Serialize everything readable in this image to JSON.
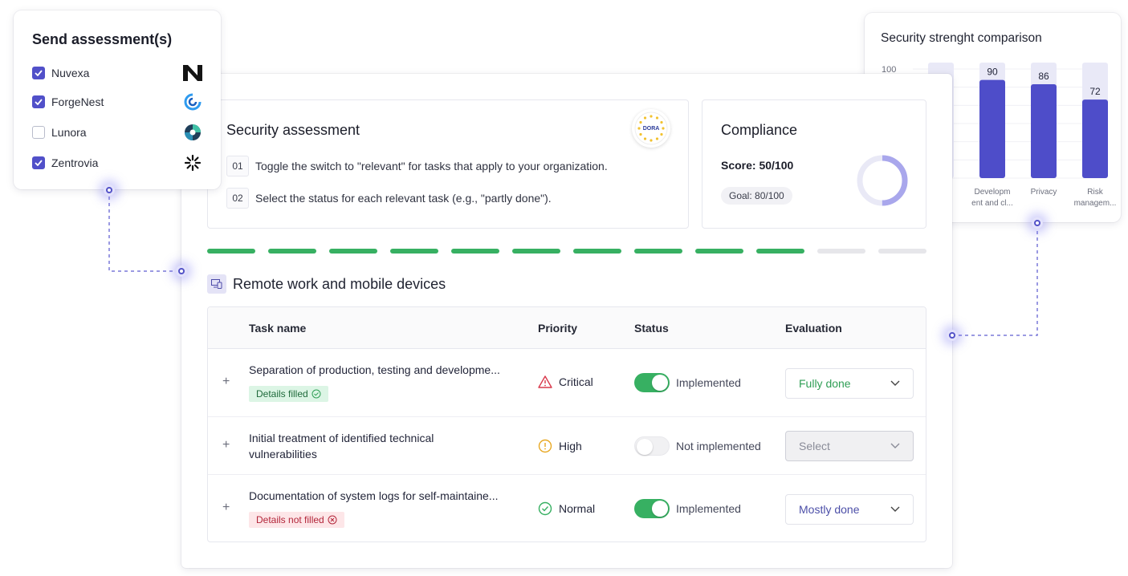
{
  "send_assessments": {
    "title": "Send assessment(s)",
    "orgs": [
      {
        "name": "Nuvexa",
        "checked": true,
        "logo": "nuvexa-logo-icon"
      },
      {
        "name": "ForgeNest",
        "checked": true,
        "logo": "forgenest-logo-icon"
      },
      {
        "name": "Lunora",
        "checked": false,
        "logo": "lunora-logo-icon"
      },
      {
        "name": "Zentrovia",
        "checked": true,
        "logo": "zentrovia-logo-icon"
      }
    ]
  },
  "strength_chart": {
    "title": "Security strenght comparison",
    "chart_data": {
      "type": "bar",
      "ylim": [
        0,
        100
      ],
      "yticks": [
        "100"
      ],
      "categories": [
        "",
        "Developm\nent and cl...",
        "Privacy",
        "Risk\nmanagem..."
      ],
      "values": [
        null,
        90,
        86,
        72
      ],
      "value_labels": [
        "",
        "90",
        "86",
        "72"
      ]
    }
  },
  "security_assessment": {
    "title": "Security assessment",
    "badge": "DORA",
    "steps": [
      {
        "num": "01",
        "text": "Toggle the switch to \"relevant\" for tasks that apply to your organization."
      },
      {
        "num": "02",
        "text": "Select the status for each relevant task (e.g., \"partly done\")."
      }
    ]
  },
  "compliance": {
    "title": "Compliance",
    "score": "Score: 50/100",
    "goal": "Goal: 80/100",
    "fraction": 0.5
  },
  "progress": {
    "total": 12,
    "done": 10,
    "colors": {
      "done": "#37b062",
      "todo": "#e6e6ea"
    }
  },
  "section": {
    "title": "Remote work and mobile devices"
  },
  "table": {
    "headers": {
      "task": "Task name",
      "priority": "Priority",
      "status": "Status",
      "evaluation": "Evaluation"
    },
    "rows": [
      {
        "task": "Separation of production, testing and developme...",
        "tag": "Details filled",
        "tag_state": "ok",
        "priority": "Critical",
        "status": "Implemented",
        "on": true,
        "evaluation": "Fully done",
        "eval_color": "#2f9e55"
      },
      {
        "task": "Initial treatment of identified technical vulnerabilities",
        "tag": "",
        "tag_state": "",
        "priority": "High",
        "status": "Not implemented",
        "on": false,
        "evaluation": "Select",
        "eval_color": "#8a8c98"
      },
      {
        "task": "Documentation of system logs for self-maintaine...",
        "tag": "Details not filled",
        "tag_state": "bad",
        "priority": "Normal",
        "status": "Implemented",
        "on": true,
        "evaluation": "Mostly done",
        "eval_color": "#4c4fa8"
      }
    ]
  },
  "colors": {
    "accent": "#5150c9",
    "success": "#37b062",
    "critical": "#d9394c",
    "high": "#e8a823"
  }
}
